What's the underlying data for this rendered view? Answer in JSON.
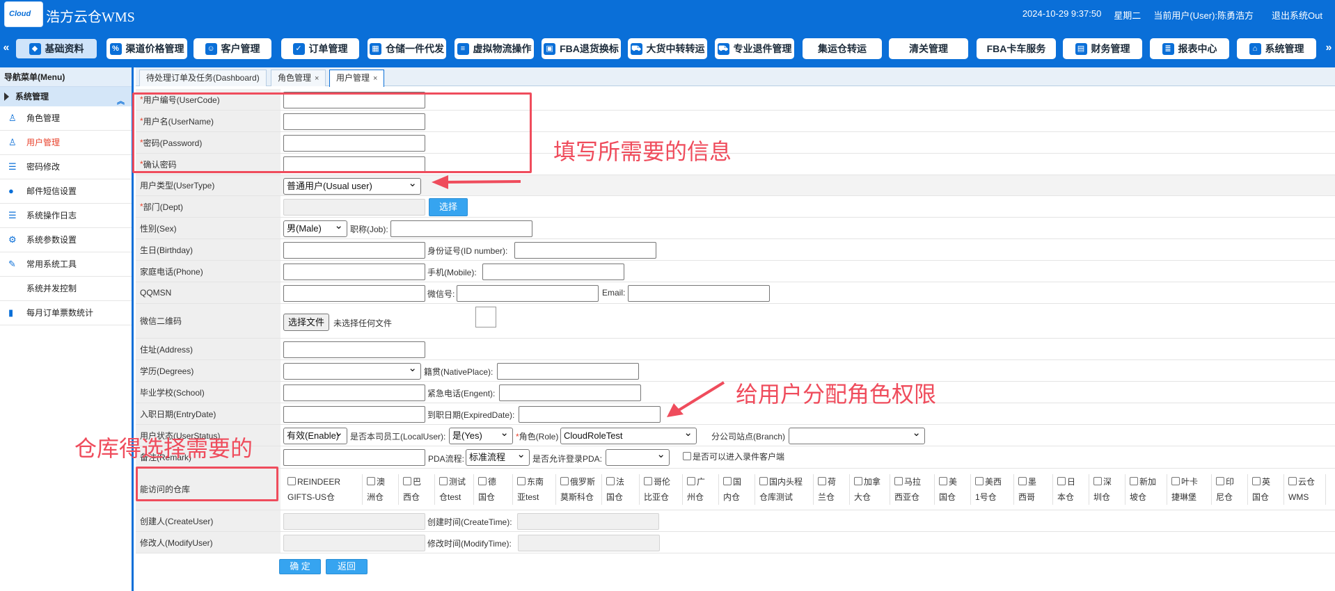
{
  "header": {
    "logo_text": "Cloud",
    "app_name": "浩方云仓WMS",
    "datetime": "2024-10-29 9:37:50",
    "weekday": "星期二",
    "current_user": "当前用户(User):陈勇浩方",
    "logout": "退出系统Out"
  },
  "nav": {
    "prev": "«",
    "next": "»",
    "items": [
      {
        "label": "基础资料",
        "icon": "tag-icon"
      },
      {
        "label": "渠道价格管理",
        "icon": "price-icon"
      },
      {
        "label": "客户管理",
        "icon": "customer-icon"
      },
      {
        "label": "订单管理",
        "icon": "order-icon"
      },
      {
        "label": "仓储一件代发",
        "icon": "warehouse-icon"
      },
      {
        "label": "虚拟物流操作",
        "icon": "logistics-icon"
      },
      {
        "label": "FBA退货换标",
        "icon": "fba-icon"
      },
      {
        "label": "大货中转转运",
        "icon": "truck-icon"
      },
      {
        "label": "专业退件管理",
        "icon": "return-icon"
      },
      {
        "label": "集运仓转运",
        "icon": ""
      },
      {
        "label": "清关管理",
        "icon": ""
      },
      {
        "label": "FBA卡车服务",
        "icon": ""
      },
      {
        "label": "财务管理",
        "icon": "finance-icon"
      },
      {
        "label": "报表中心",
        "icon": "database-icon"
      },
      {
        "label": "系统管理",
        "icon": "system-icon"
      }
    ]
  },
  "sidebar": {
    "title": "导航菜单(Menu)",
    "group": "系统管理",
    "items": [
      {
        "label": "角色管理",
        "icon": "user-icon"
      },
      {
        "label": "用户管理",
        "icon": "user-icon"
      },
      {
        "label": "密码修改",
        "icon": "list-icon"
      },
      {
        "label": "邮件短信设置",
        "icon": "mail-icon"
      },
      {
        "label": "系统操作日志",
        "icon": "list-icon"
      },
      {
        "label": "系统参数设置",
        "icon": "settings-icon"
      },
      {
        "label": "常用系统工具",
        "icon": "wrench-icon"
      },
      {
        "label": "系统并发控制",
        "icon": ""
      },
      {
        "label": "每月订单票数统计",
        "icon": "bar-chart-icon"
      }
    ]
  },
  "tabs": [
    {
      "label": "待处理订单及任务(Dashboard)",
      "close": ""
    },
    {
      "label": "角色管理",
      "close": "×"
    },
    {
      "label": "用户管理",
      "close": "×"
    }
  ],
  "form": {
    "required_mark": "*",
    "user_code": "用户编号(UserCode)",
    "user_name": "用户名(UserName)",
    "password": "密码(Password)",
    "confirm_password": "确认密码",
    "user_type": "用户类型(UserType)",
    "user_type_value": "普通用户(Usual user)",
    "dept": "部门(Dept)",
    "dept_select": "选择",
    "sex": "性别(Sex)",
    "sex_value": "男(Male)",
    "job": "职称(Job):",
    "birthday": "生日(Birthday)",
    "id_number": "身份证号(ID number):",
    "phone": "家庭电话(Phone)",
    "mobile": "手机(Mobile):",
    "qqmsn": "QQMSN",
    "wechat": "微信号:",
    "email": "Email:",
    "wechat_qr": "微信二维码",
    "choose_file": "选择文件",
    "no_file": "未选择任何文件",
    "address": "住址(Address)",
    "degrees": "学历(Degrees)",
    "native_place": "籍贯(NativePlace):",
    "school": "毕业学校(School)",
    "engent": "紧急电话(Engent):",
    "entry_date": "入职日期(EntryDate)",
    "expired_date": "到职日期(ExpiredDate):",
    "user_status": "用户状态(UserStatus)",
    "user_status_value": "有效(Enable)",
    "local_user": "是否本司员工(LocalUser):",
    "local_user_value": "是(Yes)",
    "role": "角色(Role)",
    "role_value": "CloudRoleTest",
    "branch": "分公司站点(Branch)",
    "remark": "备注(Remark)",
    "pda_flow": "PDA流程:",
    "pda_flow_value": "标准流程",
    "allow_pda": "是否允许登录PDA:",
    "customer_entry": "是否可以进入录件客户端",
    "warehouses_label": "能访问的仓库",
    "warehouses": [
      {
        "l1": "REINDEER",
        "l2": "GIFTS-US仓"
      },
      {
        "l1": "澳",
        "l2": "洲仓"
      },
      {
        "l1": "巴",
        "l2": "西仓"
      },
      {
        "l1": "测试",
        "l2": "仓test"
      },
      {
        "l1": "德",
        "l2": "国仓"
      },
      {
        "l1": "东南",
        "l2": "亚test"
      },
      {
        "l1": "俄罗斯",
        "l2": "莫斯科仓"
      },
      {
        "l1": "法",
        "l2": "国仓"
      },
      {
        "l1": "哥伦",
        "l2": "比亚仓"
      },
      {
        "l1": "广",
        "l2": "州仓"
      },
      {
        "l1": "国",
        "l2": "内仓"
      },
      {
        "l1": "国内头程",
        "l2": "仓库测试"
      },
      {
        "l1": "荷",
        "l2": "兰仓"
      },
      {
        "l1": "加拿",
        "l2": "大仓"
      },
      {
        "l1": "马拉",
        "l2": "西亚仓"
      },
      {
        "l1": "美",
        "l2": "国仓"
      },
      {
        "l1": "美西",
        "l2": "1号仓"
      },
      {
        "l1": "墨",
        "l2": "西哥"
      },
      {
        "l1": "日",
        "l2": "本仓"
      },
      {
        "l1": "深",
        "l2": "圳仓"
      },
      {
        "l1": "新加",
        "l2": "坡仓"
      },
      {
        "l1": "叶卡",
        "l2": "捷琳堡"
      },
      {
        "l1": "印",
        "l2": "尼仓"
      },
      {
        "l1": "英",
        "l2": "国仓"
      },
      {
        "l1": "云仓",
        "l2": "WMS"
      }
    ],
    "create_user": "创建人(CreateUser)",
    "create_time": "创建时间(CreateTime):",
    "modify_user": "修改人(ModifyUser)",
    "modify_time": "修改时间(ModifyTime):",
    "ok": "确 定",
    "back": "返回"
  },
  "annotations": {
    "fill_info": "填写所需要的信息",
    "assign_role": "给用户分配角色权限",
    "choose_warehouse": "仓库得选择需要的",
    "color": "#ef4c5c"
  }
}
